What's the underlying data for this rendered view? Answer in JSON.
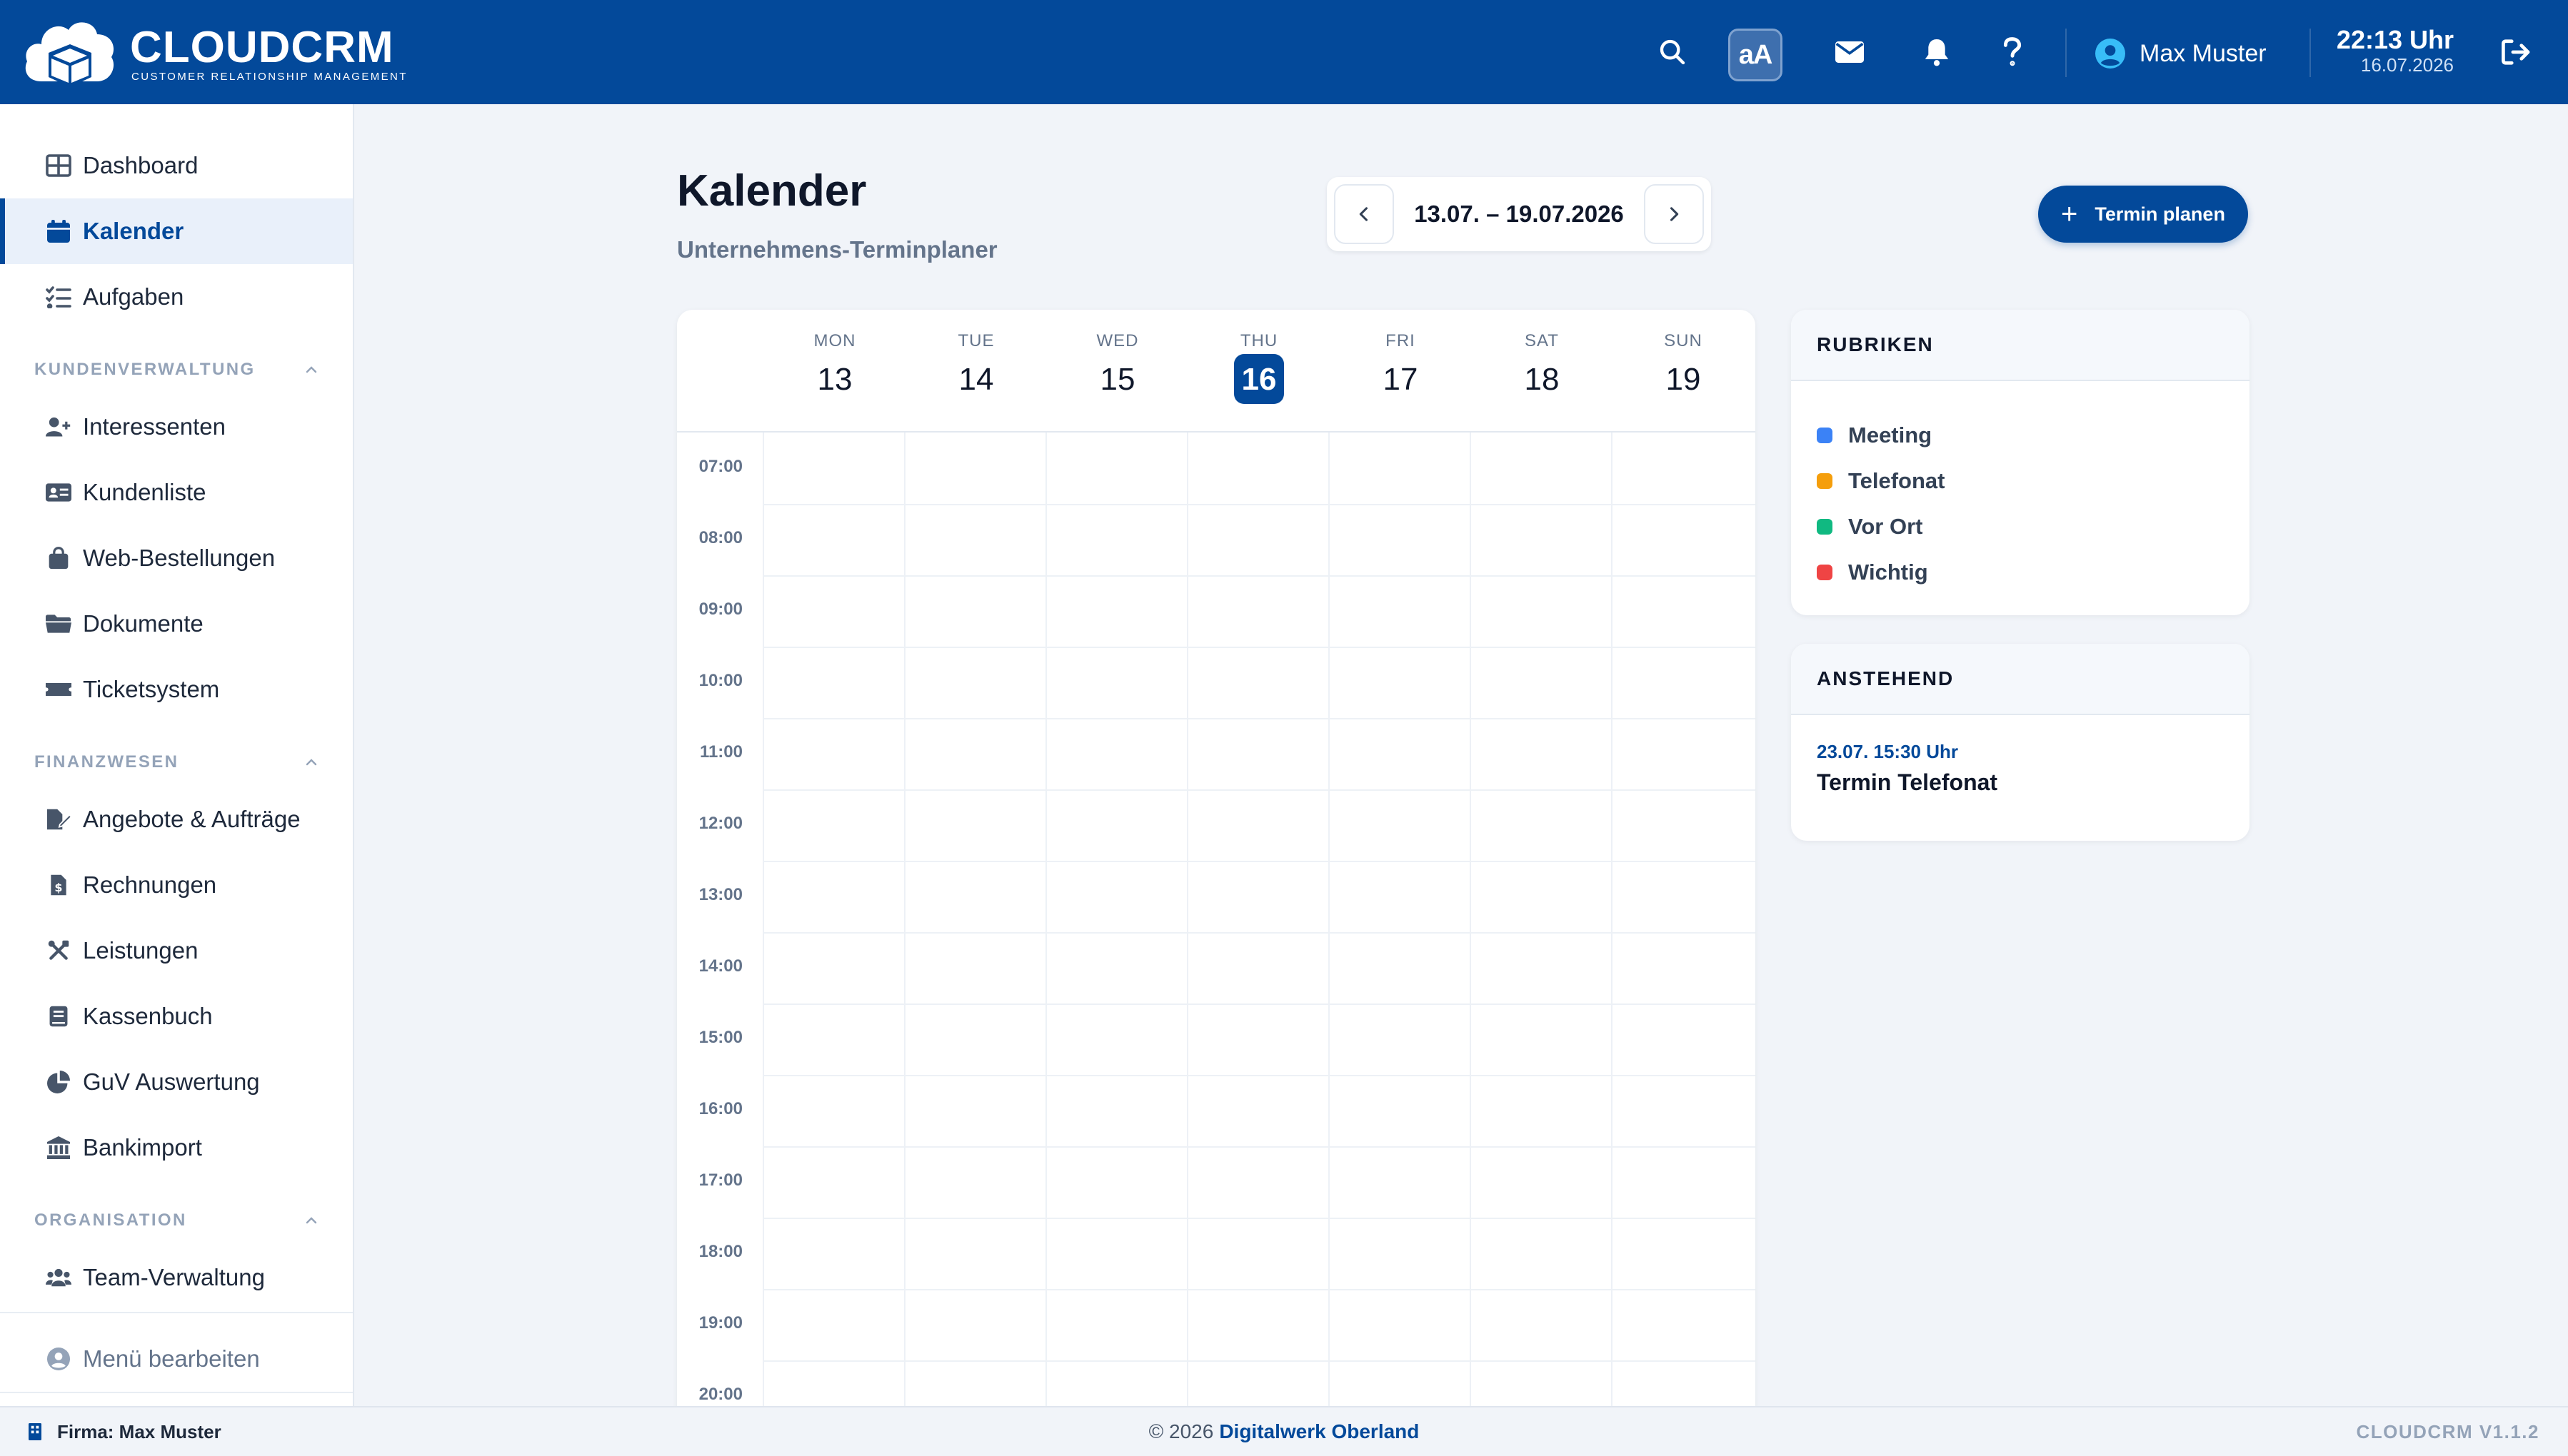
{
  "app": {
    "name": "CLOUDCRM",
    "tagline": "CUSTOMER RELATIONSHIP MANAGEMENT"
  },
  "topbar": {
    "font_toggle_label": "aA",
    "icons": [
      "search-icon",
      "font-size-icon",
      "mail-icon",
      "bell-icon",
      "help-icon",
      "user-circle-icon",
      "logout-icon"
    ],
    "user_name": "Max Muster",
    "time": "22:13 Uhr",
    "date": "16.07.2026"
  },
  "sidebar": {
    "top_items": [
      {
        "label": "Dashboard",
        "icon": "dashboard-icon"
      },
      {
        "label": "Kalender",
        "icon": "calendar-icon",
        "active": true
      },
      {
        "label": "Aufgaben",
        "icon": "tasks-icon"
      }
    ],
    "sections": [
      {
        "title": "KUNDENVERWALTUNG",
        "items": [
          {
            "label": "Interessenten",
            "icon": "user-plus-icon"
          },
          {
            "label": "Kundenliste",
            "icon": "id-card-icon"
          },
          {
            "label": "Web-Bestellungen",
            "icon": "shopping-bag-icon"
          },
          {
            "label": "Dokumente",
            "icon": "folder-icon"
          },
          {
            "label": "Ticketsystem",
            "icon": "ticket-icon"
          }
        ]
      },
      {
        "title": "FINANZWESEN",
        "items": [
          {
            "label": "Angebote & Aufträge",
            "icon": "file-signature-icon"
          },
          {
            "label": "Rechnungen",
            "icon": "invoice-icon"
          },
          {
            "label": "Leistungen",
            "icon": "tools-icon"
          },
          {
            "label": "Kassenbuch",
            "icon": "book-icon"
          },
          {
            "label": "GuV Auswertung",
            "icon": "pie-chart-icon"
          },
          {
            "label": "Bankimport",
            "icon": "bank-icon"
          }
        ]
      },
      {
        "title": "ORGANISATION",
        "items": [
          {
            "label": "Team-Verwaltung",
            "icon": "users-icon"
          }
        ]
      }
    ],
    "edit_menu_label": "Menü bearbeiten"
  },
  "main": {
    "title": "Kalender",
    "subtitle": "Unternehmens-Terminplaner",
    "week_range": "13.07. – 19.07.2026",
    "plan_button": "Termin planen"
  },
  "calendar": {
    "days": [
      {
        "name": "MON",
        "num": "13"
      },
      {
        "name": "TUE",
        "num": "14"
      },
      {
        "name": "WED",
        "num": "15"
      },
      {
        "name": "THU",
        "num": "16",
        "today": true
      },
      {
        "name": "FRI",
        "num": "17"
      },
      {
        "name": "SAT",
        "num": "18"
      },
      {
        "name": "SUN",
        "num": "19"
      }
    ],
    "hours": [
      "07:00",
      "08:00",
      "09:00",
      "10:00",
      "11:00",
      "12:00",
      "13:00",
      "14:00",
      "15:00",
      "16:00",
      "17:00",
      "18:00",
      "19:00",
      "20:00"
    ]
  },
  "rubriken": {
    "title": "RUBRIKEN",
    "items": [
      {
        "label": "Meeting",
        "color": "#3b82f6"
      },
      {
        "label": "Telefonat",
        "color": "#f59e0b"
      },
      {
        "label": "Vor Ort",
        "color": "#10b981"
      },
      {
        "label": "Wichtig",
        "color": "#ef4444"
      }
    ]
  },
  "anstehend": {
    "title": "ANSTEHEND",
    "items": [
      {
        "date": "23.07. 15:30 Uhr",
        "title": "Termin Telefonat"
      }
    ]
  },
  "footer": {
    "company": "Firma: Max Muster",
    "copyright": "© 2026",
    "brand": "Digitalwerk Oberland",
    "version": "CLOUDCRM V1.1.2"
  },
  "colors": {
    "primary": "#03499a",
    "background": "#f1f4f9",
    "muted": "#64748b"
  }
}
